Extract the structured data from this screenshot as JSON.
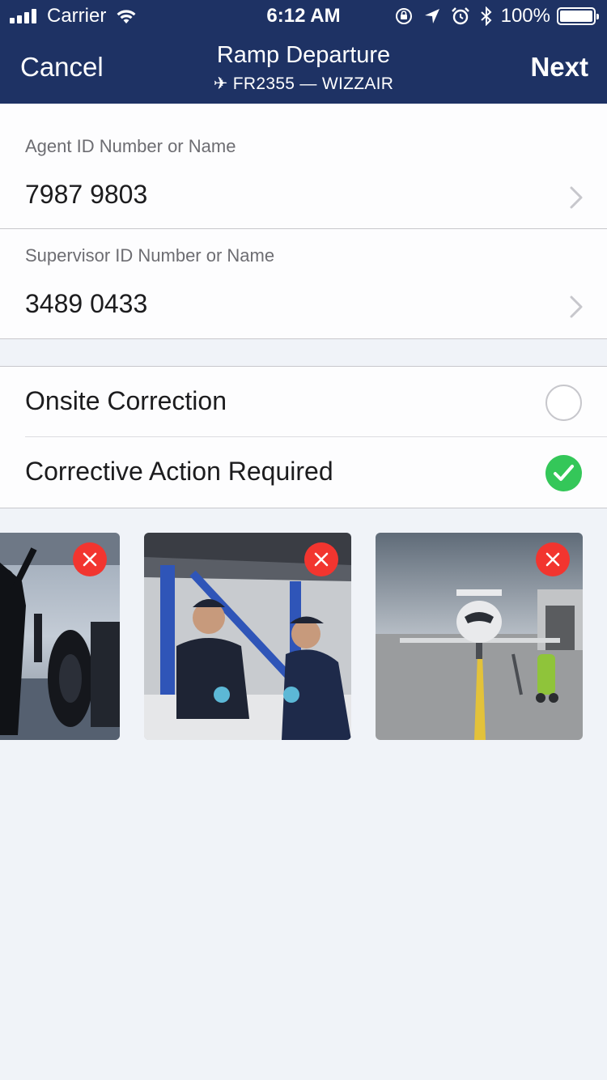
{
  "status_bar": {
    "carrier": "Carrier",
    "time": "6:12 AM",
    "battery": "100%"
  },
  "nav": {
    "cancel_label": "Cancel",
    "title": "Ramp Departure",
    "subtitle": "✈ FR2355 — WIZZAIR",
    "next_label": "Next",
    "background_color": "#1e3264"
  },
  "form": {
    "agent": {
      "label": "Agent ID Number or Name",
      "value": "7987 9803"
    },
    "supervisor": {
      "label": "Supervisor ID Number or Name",
      "value": "3489 0433"
    }
  },
  "options": [
    {
      "label": "Onsite Correction",
      "selected": false
    },
    {
      "label": "Corrective Action Required",
      "selected": true
    }
  ],
  "photos": [
    {
      "subject": "aircraft-landing-gear-ground-crew"
    },
    {
      "subject": "mechanics-working-under-aircraft"
    },
    {
      "subject": "business-jet-on-tarmac"
    }
  ],
  "colors": {
    "accent_green": "#34c759",
    "remove_red": "#f2352f"
  },
  "icons": [
    "wifi-icon",
    "rotation-lock-icon",
    "location-arrow-icon",
    "alarm-icon",
    "bluetooth-icon",
    "chevron-right-icon",
    "checkmark-icon",
    "close-icon"
  ]
}
